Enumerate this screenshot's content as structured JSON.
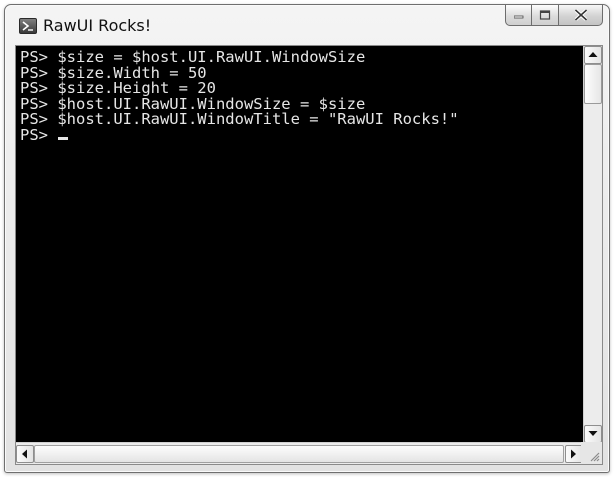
{
  "window": {
    "title": "RawUI Rocks!"
  },
  "console": {
    "lines": [
      "PS> $size = $host.UI.RawUI.WindowSize",
      "PS> $size.Width = 50",
      "PS> $size.Height = 20",
      "PS> $host.UI.RawUI.WindowSize = $size",
      "PS> $host.UI.RawUI.WindowTitle = \"RawUI Rocks!\"",
      "PS>"
    ],
    "background": "#000000",
    "foreground": "#e6e6e6"
  },
  "icons": {
    "app": "powershell-prompt-icon",
    "minimize": "minimize-icon",
    "maximize": "maximize-icon",
    "close": "close-icon"
  }
}
